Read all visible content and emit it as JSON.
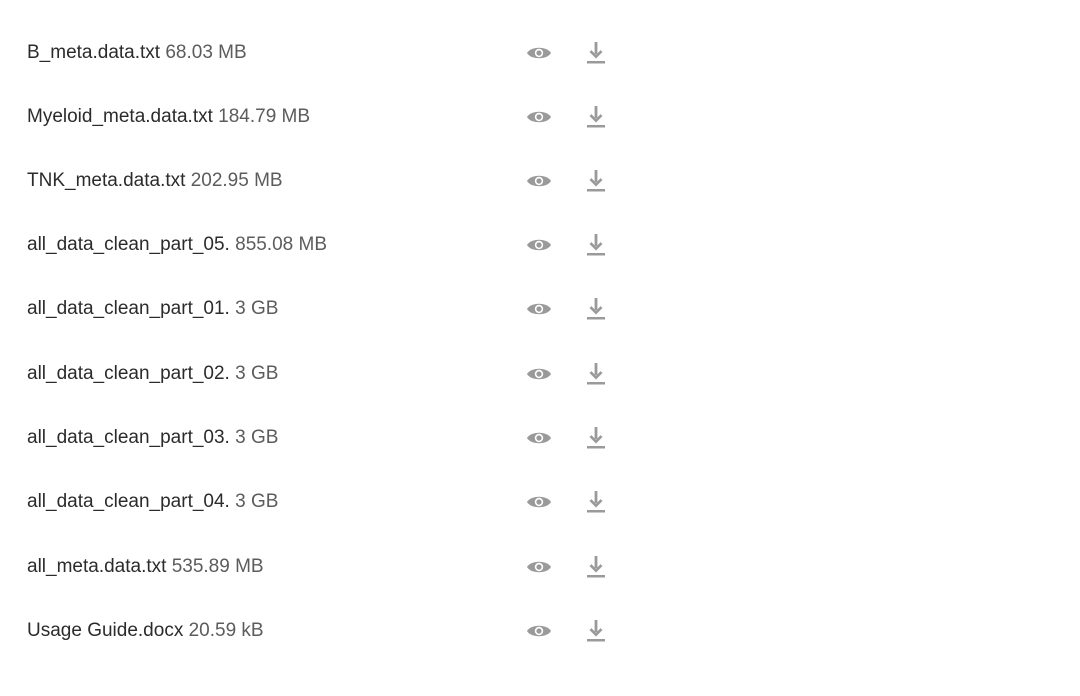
{
  "files": [
    {
      "name": "B_meta.data.txt",
      "size": "68.03 MB"
    },
    {
      "name": "Myeloid_meta.data.txt",
      "size": "184.79 MB"
    },
    {
      "name": "TNK_meta.data.txt",
      "size": "202.95 MB"
    },
    {
      "name": "all_data_clean_part_05.",
      "size": "855.08 MB"
    },
    {
      "name": "all_data_clean_part_01.",
      "size": "3 GB"
    },
    {
      "name": "all_data_clean_part_02.",
      "size": "3 GB"
    },
    {
      "name": "all_data_clean_part_03.",
      "size": "3 GB"
    },
    {
      "name": "all_data_clean_part_04.",
      "size": "3 GB"
    },
    {
      "name": "all_meta.data.txt",
      "size": "535.89 MB"
    },
    {
      "name": "Usage Guide.docx",
      "size": "20.59 kB"
    }
  ],
  "icons": {
    "preview": "eye-icon",
    "download": "download-icon"
  },
  "colors": {
    "file_name": "#2b2b2b",
    "file_size": "#5c5c5c",
    "icon": "#9a9a9a"
  }
}
